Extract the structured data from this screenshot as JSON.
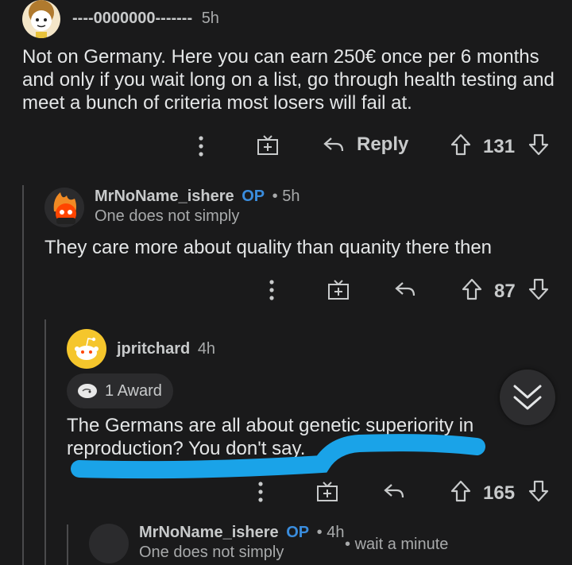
{
  "comments": [
    {
      "author": "----0000000-------",
      "time": "5h",
      "body": "Not on Germany. Here you can earn 250€ once per 6 months and only if you wait long on a list, go through health testing and meet a bunch of criteria most losers will fail at.",
      "reply_label": "Reply",
      "votes": "131"
    },
    {
      "author": "MrNoName_ishere",
      "op": "OP",
      "time": "5h",
      "flair": "One does not simply",
      "body": "They care more about quality than quanity there then",
      "votes": "87"
    },
    {
      "author": "jpritchard",
      "time": "4h",
      "award": "1 Award",
      "body": "The Germans are all about genetic superiority in reproduction? You don't say.",
      "votes": "165"
    },
    {
      "author": "MrNoName_ishere",
      "op": "OP",
      "time": "4h",
      "flair": "One does not simply",
      "collapsed_text": "wait a minute"
    }
  ],
  "colors": {
    "background": "#1a1a1b",
    "op": "#3a8dde",
    "annotation": "#1aa3e8"
  },
  "icons": [
    "more-icon",
    "gift-icon",
    "reply-icon",
    "upvote-icon",
    "downvote-icon",
    "chevron-down-icon"
  ]
}
